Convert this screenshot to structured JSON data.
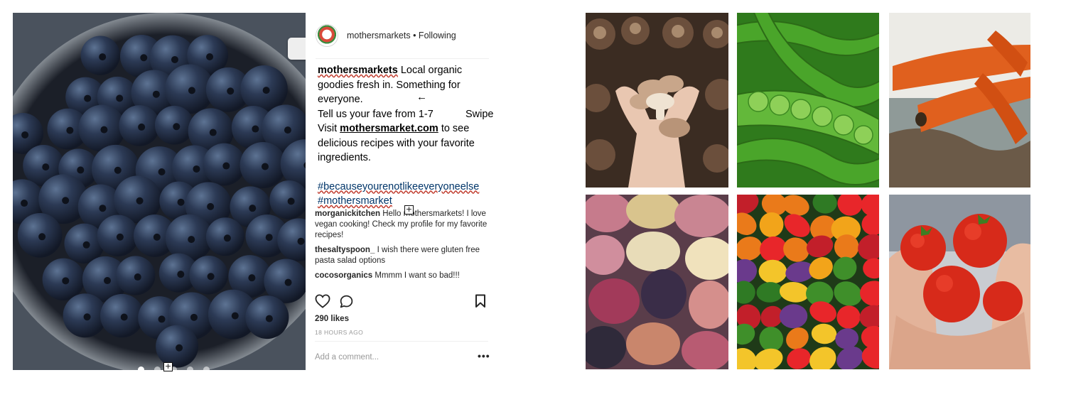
{
  "post": {
    "username": "mothersmarkets",
    "following_label": "Following",
    "header_text": "mothersmarkets • Following",
    "caption": {
      "text_line1": "Local organic goodies fresh in. Something for everyone.",
      "line2": "Tell us your fave from 1-7",
      "swipe_note": "Swipe",
      "visit_prefix": "Visit",
      "link": "mothersmarket.com",
      "visit_suffix": "to see delicious recipes with your favorite ingredients.",
      "hashtag1": "#becauseyourenotlikeeveryoneelse",
      "hashtag2": "#mothersmarket"
    },
    "comments": [
      {
        "user": "morganickitchen",
        "text": "Hello mothersmarkets! I love vegan cooking! Check my profile for my favorite recipes!"
      },
      {
        "user": "thesaltyspoon_",
        "text": "I wish there were gluten free pasta salad options"
      },
      {
        "user": "cocosorganics",
        "text": "Mmmm I want so bad!!!"
      }
    ],
    "likes": "290 likes",
    "timestamp": "18 HOURS AGO",
    "add_comment_placeholder": "Add a comment...",
    "more_label": "•••",
    "carousel_pages": 5,
    "carousel_active_index": 0
  },
  "icons": {
    "like": "heart-icon",
    "comment": "comment-bubble-icon",
    "save": "bookmark-icon",
    "arrow": "arrow-left-icon"
  },
  "glyphs": {
    "arrow": "←",
    "plus": "+"
  },
  "colors": {
    "text": "#262626",
    "link": "#003569",
    "muted": "#999999",
    "divider": "#efefef"
  },
  "grid_tiles": [
    "mushrooms",
    "snap-peas",
    "carrots",
    "potatoes",
    "mini-peppers",
    "tomatoes"
  ]
}
